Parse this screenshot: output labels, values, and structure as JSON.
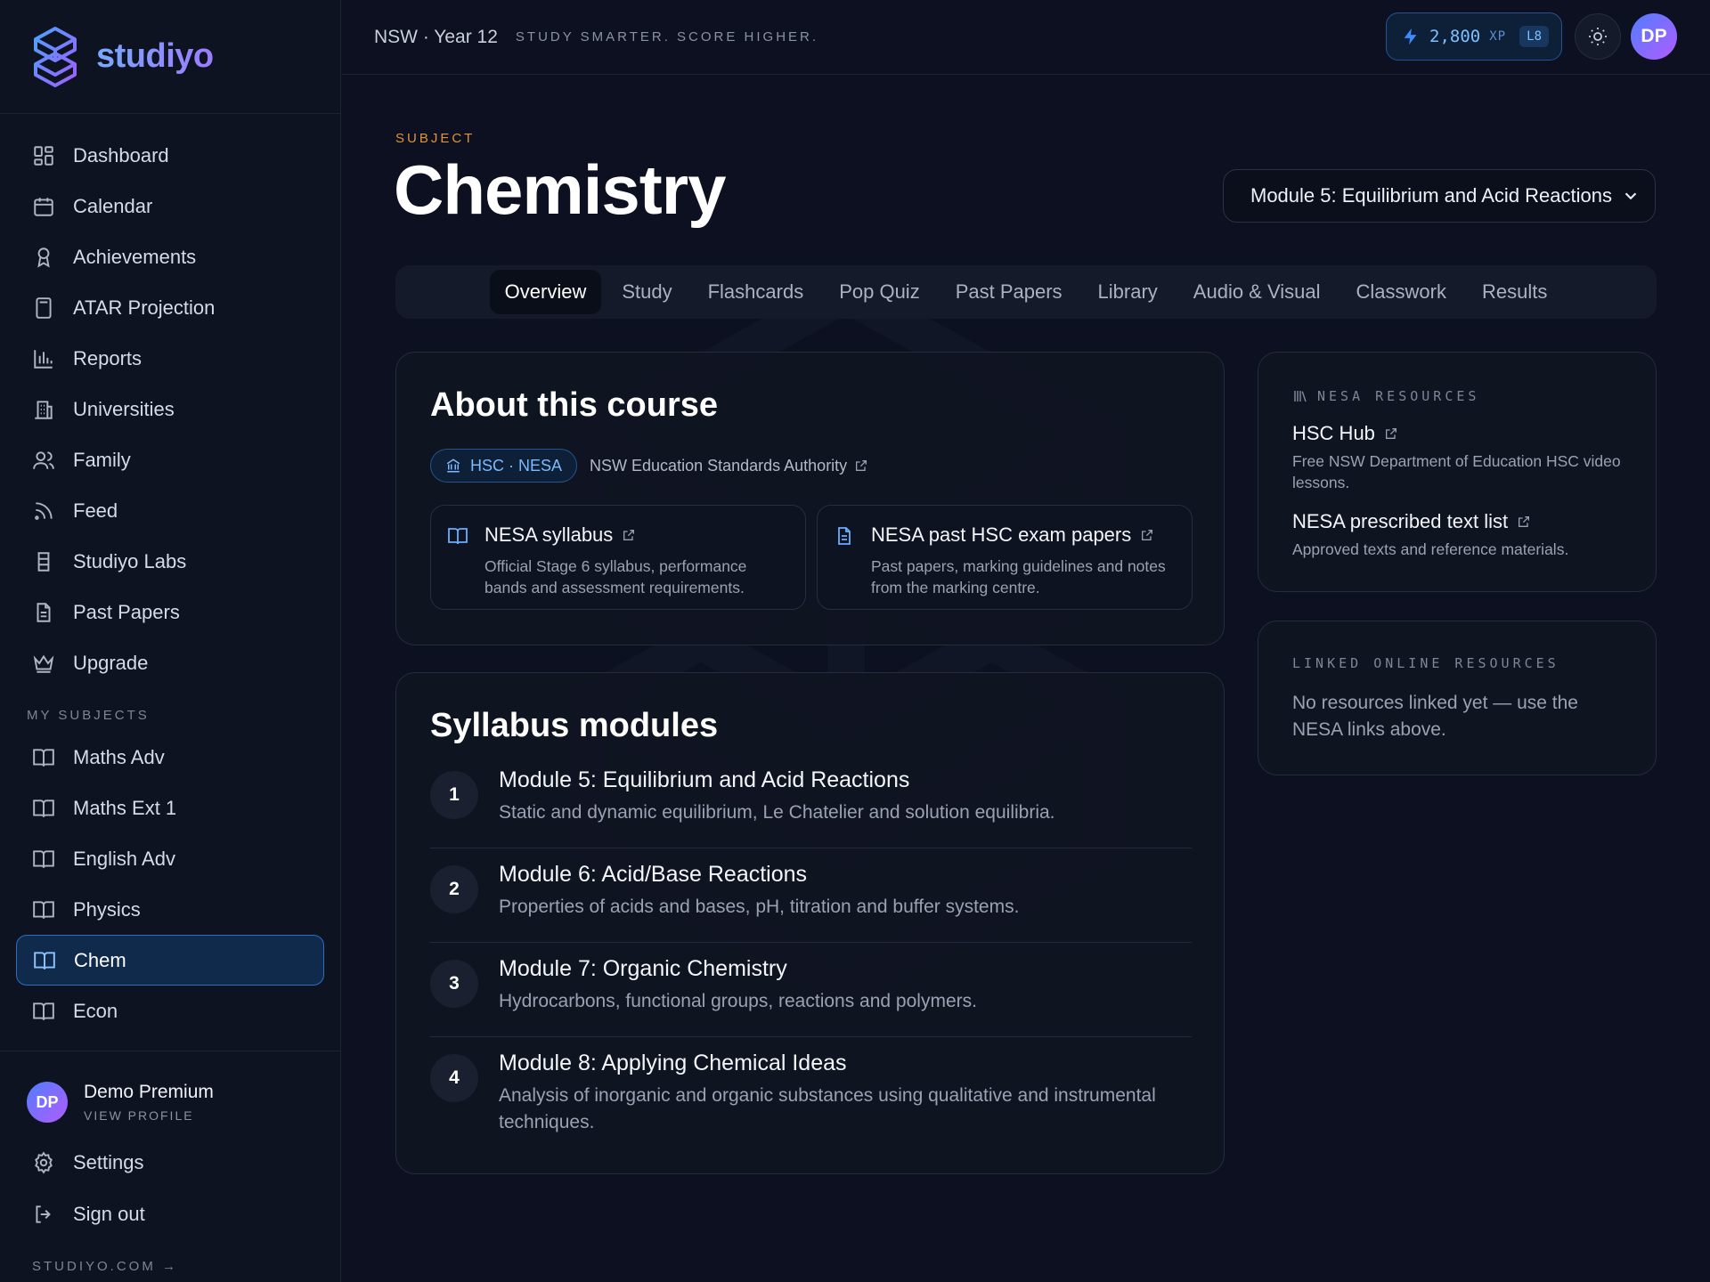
{
  "brand": {
    "name": "studiyo"
  },
  "sidebar": {
    "items": [
      {
        "label": "Dashboard",
        "icon": "dashboard-icon"
      },
      {
        "label": "Calendar",
        "icon": "calendar-icon"
      },
      {
        "label": "Achievements",
        "icon": "award-icon"
      },
      {
        "label": "ATAR Projection",
        "icon": "calculator-icon"
      },
      {
        "label": "Reports",
        "icon": "bar-chart-icon"
      },
      {
        "label": "Universities",
        "icon": "building-icon"
      },
      {
        "label": "Family",
        "icon": "users-icon"
      },
      {
        "label": "Feed",
        "icon": "rss-icon"
      },
      {
        "label": "Studiyo Labs",
        "icon": "beaker-icon"
      },
      {
        "label": "Past Papers",
        "icon": "document-icon"
      },
      {
        "label": "Upgrade",
        "icon": "crown-icon"
      }
    ],
    "subjects_label": "MY SUBJECTS",
    "subjects": [
      {
        "label": "Maths Adv",
        "active": false
      },
      {
        "label": "Maths Ext 1",
        "active": false
      },
      {
        "label": "English Adv",
        "active": false
      },
      {
        "label": "Physics",
        "active": false
      },
      {
        "label": "Chem",
        "active": true
      },
      {
        "label": "Econ",
        "active": false
      }
    ],
    "profile": {
      "initials": "DP",
      "name": "Demo Premium",
      "sub": "VIEW PROFILE"
    },
    "settings": "Settings",
    "signout": "Sign out",
    "site": "STUDIYO.COM →"
  },
  "topbar": {
    "region": "NSW · Year 12",
    "tagline": "STUDY SMARTER. SCORE HIGHER.",
    "xp_value": "2,800",
    "xp_unit": "XP",
    "level": "L8",
    "avatar_initials": "DP"
  },
  "page": {
    "eyebrow": "SUBJECT",
    "title": "Chemistry",
    "module_select": "Module 5: Equilibrium and Acid Reactions",
    "tabs": [
      "Overview",
      "Study",
      "Flashcards",
      "Pop Quiz",
      "Past Papers",
      "Library",
      "Audio & Visual",
      "Classwork",
      "Results"
    ],
    "active_tab": "Overview"
  },
  "about": {
    "title": "About this course",
    "chip": "HSC · NESA",
    "authority": "NSW Education Standards Authority",
    "resources": [
      {
        "title": "NESA syllabus",
        "desc": "Official Stage 6 syllabus, performance bands and assessment requirements."
      },
      {
        "title": "NESA past HSC exam papers",
        "desc": "Past papers, marking guidelines and notes from the marking centre."
      }
    ]
  },
  "modules": {
    "title": "Syllabus modules",
    "items": [
      {
        "num": "1",
        "title": "Module 5: Equilibrium and Acid Reactions",
        "desc": "Static and dynamic equilibrium, Le Chatelier and solution equilibria."
      },
      {
        "num": "2",
        "title": "Module 6: Acid/Base Reactions",
        "desc": "Properties of acids and bases, pH, titration and buffer systems."
      },
      {
        "num": "3",
        "title": "Module 7: Organic Chemistry",
        "desc": "Hydrocarbons, functional groups, reactions and polymers."
      },
      {
        "num": "4",
        "title": "Module 8: Applying Chemical Ideas",
        "desc": "Analysis of inorganic and organic substances using qualitative and instrumental techniques."
      }
    ]
  },
  "nesa": {
    "label": "NESA RESOURCES",
    "links": [
      {
        "title": "HSC Hub",
        "desc": "Free NSW Department of Education HSC video lessons."
      },
      {
        "title": "NESA prescribed text list",
        "desc": "Approved texts and reference materials."
      }
    ]
  },
  "linked": {
    "label": "LINKED ONLINE RESOURCES",
    "empty": "No resources linked yet — use the NESA links above."
  },
  "colors": {
    "accent": "#2a6fc2",
    "eyebrow": "#e0933a",
    "background": "#0c1020"
  }
}
